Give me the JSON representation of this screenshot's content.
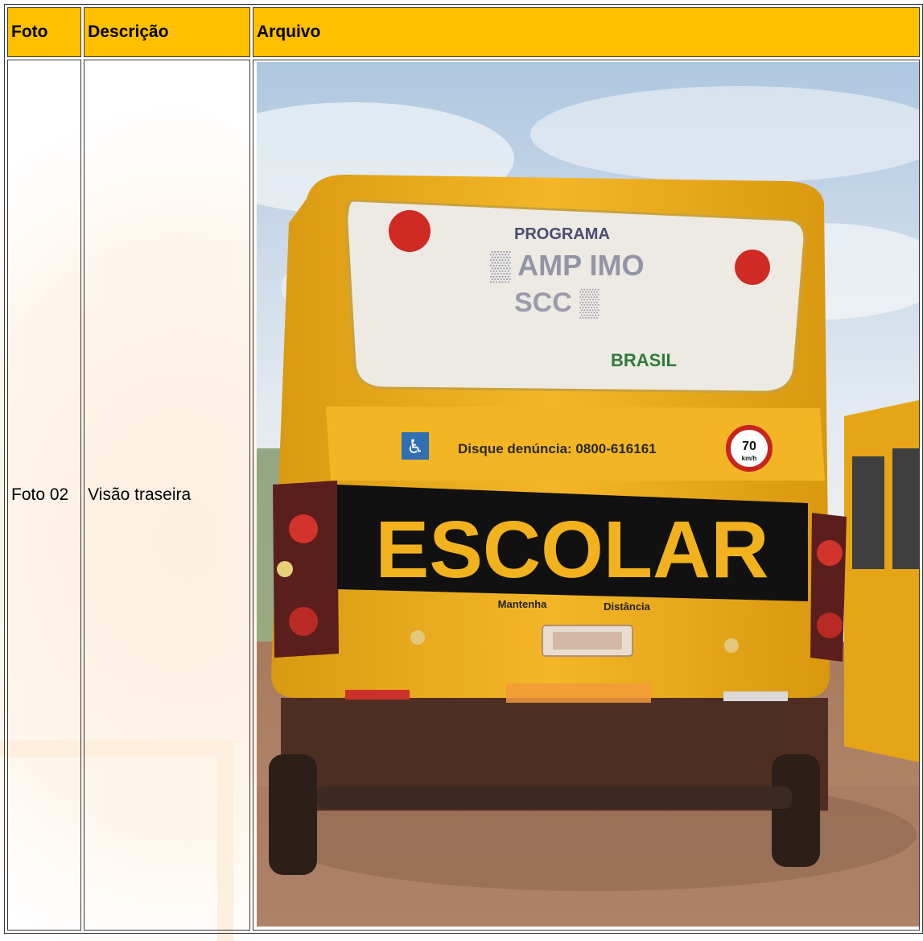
{
  "table": {
    "headers": {
      "foto": "Foto",
      "descricao": "Descrição",
      "arquivo": "Arquivo"
    },
    "rows": [
      {
        "foto": "Foto 02",
        "descricao": "Visão traseira",
        "image": {
          "sticker_main": "ESCOLAR",
          "sticker_left": "Mantenha",
          "sticker_right": "Distância",
          "hotline": "Disque denúncia: 0800-616161",
          "speed_limit": "70",
          "speed_unit": "km/h",
          "window_brand": "BRASIL",
          "window_program": "PROGRAMA"
        }
      }
    ]
  },
  "colors": {
    "header_bg": "#ffc000",
    "bus_yellow": "#f2b21e",
    "sky": "#c9daea"
  }
}
